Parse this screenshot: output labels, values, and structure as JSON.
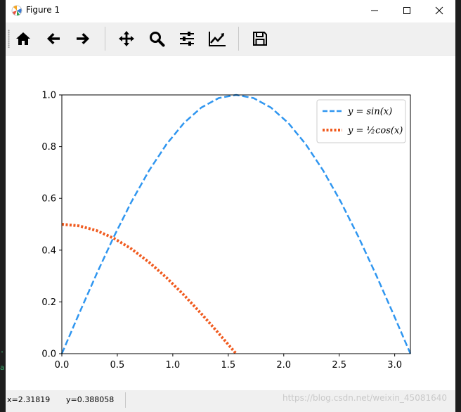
{
  "window": {
    "title": "Figure 1"
  },
  "toolbar": {
    "buttons": [
      {
        "name": "home-icon"
      },
      {
        "name": "back-icon"
      },
      {
        "name": "forward-icon"
      },
      {
        "name": "pan-icon"
      },
      {
        "name": "zoom-icon"
      },
      {
        "name": "configure-subplots-icon"
      },
      {
        "name": "edit-axis-icon"
      },
      {
        "name": "save-icon"
      }
    ]
  },
  "chart_data": {
    "type": "line",
    "title": "",
    "xlabel": "",
    "ylabel": "",
    "xlim": [
      0,
      3.14159
    ],
    "ylim": [
      0,
      1.0
    ],
    "xticks": [
      "0.0",
      "0.5",
      "1.0",
      "1.5",
      "2.0",
      "2.5",
      "3.0"
    ],
    "yticks": [
      "0.0",
      "0.2",
      "0.4",
      "0.6",
      "0.8",
      "1.0"
    ],
    "legend_position": "upper right",
    "grid": false,
    "series": [
      {
        "name": "y = sin(x)",
        "color": "#2f96f0",
        "style": "dashed",
        "x": [
          0,
          0.1571,
          0.3142,
          0.4712,
          0.6283,
          0.7854,
          0.9425,
          1.0996,
          1.2566,
          1.4137,
          1.5708,
          1.7279,
          1.885,
          2.042,
          2.1991,
          2.3562,
          2.5133,
          2.6704,
          2.8274,
          2.9845,
          3.1416
        ],
        "y": [
          0,
          0.1564,
          0.309,
          0.454,
          0.5878,
          0.7071,
          0.809,
          0.891,
          0.9511,
          0.9877,
          1.0,
          0.9877,
          0.9511,
          0.891,
          0.809,
          0.7071,
          0.5878,
          0.454,
          0.309,
          0.1564,
          0
        ]
      },
      {
        "name": "y = ½cos(x)",
        "color": "#f05a1e",
        "style": "dotted",
        "x": [
          0,
          0.1571,
          0.3142,
          0.4712,
          0.6283,
          0.7854,
          0.9425,
          1.0996,
          1.2566,
          1.4137,
          1.5708
        ],
        "y": [
          0.5,
          0.4938,
          0.4755,
          0.4455,
          0.4045,
          0.3536,
          0.2939,
          0.227,
          0.1545,
          0.0782,
          0
        ]
      }
    ]
  },
  "status": {
    "x_readout": "x=2.31819",
    "y_readout": "y=0.388058",
    "watermark": "https://blog.csdn.net/weixin_45081640"
  }
}
